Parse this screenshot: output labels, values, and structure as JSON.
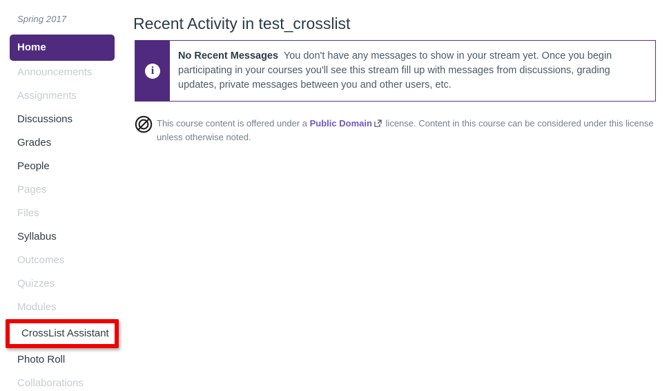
{
  "sidebar": {
    "term_label": "Spring 2017",
    "items": [
      {
        "label": "Home",
        "state": "active"
      },
      {
        "label": "Announcements",
        "state": "dim"
      },
      {
        "label": "Assignments",
        "state": "dim"
      },
      {
        "label": "Discussions",
        "state": "normal"
      },
      {
        "label": "Grades",
        "state": "normal"
      },
      {
        "label": "People",
        "state": "normal"
      },
      {
        "label": "Pages",
        "state": "dim"
      },
      {
        "label": "Files",
        "state": "dim"
      },
      {
        "label": "Syllabus",
        "state": "normal"
      },
      {
        "label": "Outcomes",
        "state": "dim"
      },
      {
        "label": "Quizzes",
        "state": "dim"
      },
      {
        "label": "Modules",
        "state": "dim"
      },
      {
        "label": "CrossList Assistant",
        "state": "annotated"
      },
      {
        "label": "Photo Roll",
        "state": "normal"
      },
      {
        "label": "Collaborations",
        "state": "dim"
      }
    ]
  },
  "main": {
    "page_title": "Recent Activity in test_crosslist",
    "alert": {
      "icon": "info-icon",
      "heading": "No Recent Messages",
      "message": "You don't have any messages to show in your stream yet. Once you begin participating in your courses you'll see this stream fill up with messages from discussions, grading updates, private messages between you and other users, etc."
    },
    "license": {
      "icon": "public-domain-icon",
      "text_before_link": "This course content is offered under a",
      "link_label": "Public Domain",
      "link_icon": "external-link-icon",
      "text_after_link": "license. Content in this course can be considered under this license unless otherwise noted."
    }
  },
  "colors": {
    "brand_purple": "#4F2A7F",
    "alert_border": "#5B3389",
    "annotation_red": "#EE0000",
    "link_purple": "#6B59C6",
    "text_dark": "#2D3B45",
    "text_muted": "#73818C",
    "text_disabled": "#C7CDD1"
  }
}
